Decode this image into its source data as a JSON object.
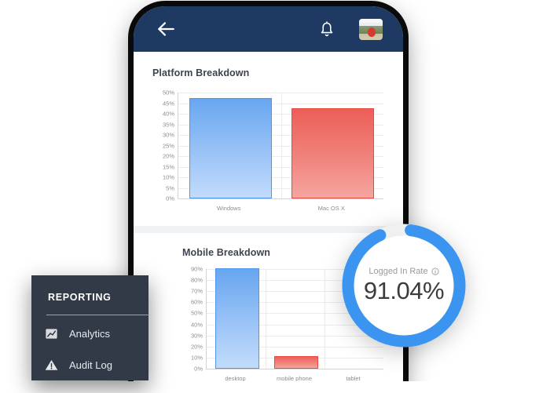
{
  "app_bar": {
    "back_icon": "back-arrow-icon",
    "bell_icon": "bell-icon",
    "avatar_icon": "avatar"
  },
  "platform_card": {
    "title": "Platform Breakdown"
  },
  "mobile_card": {
    "title": "Mobile Breakdown"
  },
  "gauge": {
    "label": "Logged In Rate",
    "info_icon": "info-icon",
    "value": "91.04%",
    "percent": 91.04,
    "arc_color": "#3b94f0",
    "track_color": "#f0f0f0"
  },
  "reporting": {
    "title": "REPORTING",
    "items": [
      {
        "label": "Analytics",
        "icon": "analytics-chart-icon"
      },
      {
        "label": "Audit Log",
        "icon": "warning-triangle-icon"
      }
    ],
    "panel_color": "#323a47"
  },
  "chart_data": [
    {
      "type": "bar",
      "title": "Platform Breakdown",
      "categories": [
        "Windows",
        "Mac OS X"
      ],
      "values": [
        46.5,
        42
      ],
      "colors": [
        "#68a6f0",
        "#ec5f58"
      ],
      "xlabel": "",
      "ylabel": "",
      "ylim": [
        0,
        50
      ],
      "ytick_step": 5,
      "yticks": [
        "0%",
        "5%",
        "10%",
        "15%",
        "20%",
        "25%",
        "30%",
        "35%",
        "40%",
        "45%",
        "50%"
      ],
      "grid": true,
      "legend": "none"
    },
    {
      "type": "bar",
      "title": "Mobile Breakdown",
      "categories": [
        "desktop",
        "mobile phone",
        "tablet"
      ],
      "values": [
        89,
        10,
        0
      ],
      "colors": [
        "#68a6f0",
        "#ec5f58",
        "#f0a35c"
      ],
      "xlabel": "",
      "ylabel": "",
      "ylim": [
        0,
        90
      ],
      "ytick_step": 10,
      "yticks": [
        "0%",
        "10%",
        "20%",
        "30%",
        "40%",
        "50%",
        "60%",
        "70%",
        "80%",
        "90%"
      ],
      "grid": true,
      "legend": "none"
    }
  ]
}
